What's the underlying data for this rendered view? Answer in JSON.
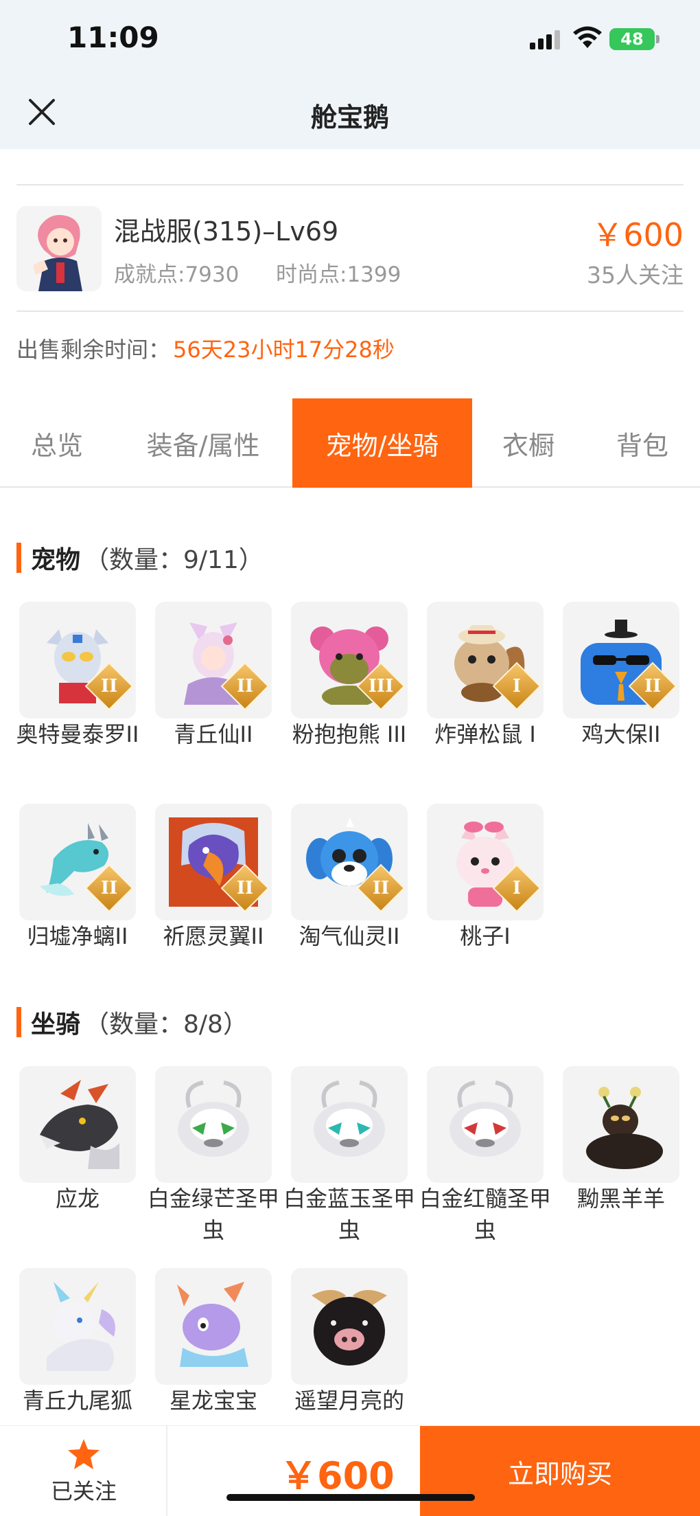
{
  "status": {
    "time": "11:09",
    "battery": "48"
  },
  "nav": {
    "title": "舱宝鹅"
  },
  "account": {
    "server": "混战服(315)–Lv69",
    "achievement": "成就点:7930",
    "fashion": "时尚点:1399",
    "price": "￥600",
    "followers": "35人关注"
  },
  "sale": {
    "remain_label": "出售剩余时间：",
    "remain_value": "56天23小时17分28秒"
  },
  "tabs": [
    {
      "label": "总览"
    },
    {
      "label": "装备/属性"
    },
    {
      "label": "宠物/坐骑"
    },
    {
      "label": "衣橱"
    },
    {
      "label": "背包"
    }
  ],
  "pets": {
    "title": "宠物",
    "count": "（数量：9/11）",
    "items": [
      {
        "name": "奥特曼泰罗II",
        "grade": "II",
        "icon": "ultraman-pet-icon"
      },
      {
        "name": "青丘仙II",
        "grade": "II",
        "icon": "fox-fairy-pet-icon"
      },
      {
        "name": "粉抱抱熊 III",
        "grade": "III",
        "icon": "pink-bear-pet-icon"
      },
      {
        "name": "炸弹松鼠 I",
        "grade": "I",
        "icon": "squirrel-pet-icon"
      },
      {
        "name": "鸡大保II",
        "grade": "II",
        "icon": "blue-bird-pet-icon"
      },
      {
        "name": "归墟净螭II",
        "grade": "II",
        "icon": "dragon-pet-icon"
      },
      {
        "name": "祈愿灵翼II",
        "grade": "II",
        "icon": "eagle-pet-icon"
      },
      {
        "name": "淘气仙灵II",
        "grade": "II",
        "icon": "blue-dog-pet-icon"
      },
      {
        "name": "桃子I",
        "grade": "I",
        "icon": "pink-cat-pet-icon"
      }
    ]
  },
  "mounts": {
    "title": "坐骑",
    "count": "（数量：8/8）",
    "items": [
      {
        "name": "应龙",
        "icon": "black-dragon-mount-icon"
      },
      {
        "name": "白金绿芒圣甲虫",
        "icon": "beetle-green-mount-icon"
      },
      {
        "name": "白金蓝玉圣甲虫",
        "icon": "beetle-blue-mount-icon"
      },
      {
        "name": "白金红髓圣甲虫",
        "icon": "beetle-red-mount-icon"
      },
      {
        "name": "黝黑羊羊",
        "icon": "black-sheep-mount-icon"
      },
      {
        "name": "青丘九尾狐",
        "icon": "nine-tail-fox-mount-icon"
      },
      {
        "name": "星龙宝宝",
        "icon": "star-dragon-mount-icon"
      },
      {
        "name": "遥望月亮的",
        "icon": "black-pig-mount-icon"
      }
    ]
  },
  "bottom": {
    "follow_label": "已关注",
    "price": "￥600",
    "buy_label": "立即购买"
  },
  "colors": {
    "accent": "#ff6410",
    "topbar": "#eef4f8",
    "grade_gold": "#d89a2a"
  }
}
